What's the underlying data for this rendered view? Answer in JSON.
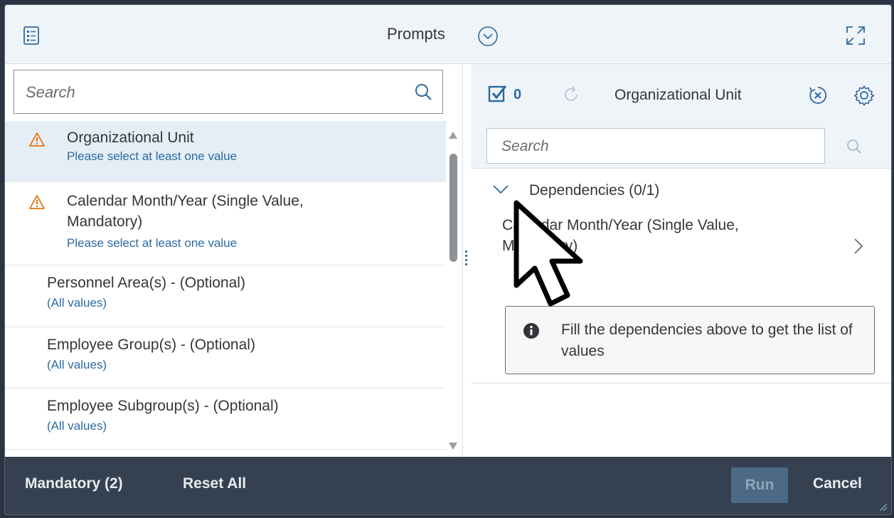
{
  "header": {
    "title": "Prompts"
  },
  "left_panel": {
    "search": {
      "placeholder": "Search",
      "value": ""
    },
    "items": [
      {
        "label": "Organizational Unit",
        "status": "Please select at least one value",
        "warning": true,
        "selected": true
      },
      {
        "label": "Calendar Month/Year (Single Value, Mandatory)",
        "label_line1": "Calendar Month/Year (Single Value,",
        "label_line2": "Mandatory)",
        "status": "Please select at least one value",
        "warning": true,
        "selected": false
      },
      {
        "label": "Personnel Area(s) - (Optional)",
        "status": "(All values)",
        "warning": false,
        "selected": false
      },
      {
        "label": "Employee Group(s) - (Optional)",
        "status": "(All values)",
        "warning": false,
        "selected": false
      },
      {
        "label": "Employee Subgroup(s) - (Optional)",
        "status": "(All values)",
        "warning": false,
        "selected": false
      }
    ]
  },
  "right_panel": {
    "selected_count": "0",
    "title": "Organizational Unit",
    "search": {
      "placeholder": "Search",
      "value": ""
    },
    "dependencies": {
      "header": "Dependencies (0/1)",
      "items": [
        {
          "line1": "Calendar Month/Year (Single Value,",
          "line2": "Mandatory)"
        }
      ]
    },
    "info_message": "Fill the dependencies above to get the list of values"
  },
  "footer": {
    "mandatory": "Mandatory (2)",
    "reset_all": "Reset All",
    "run": "Run",
    "cancel": "Cancel"
  },
  "colors": {
    "accent": "#2c6aa0",
    "warning": "#e9730c",
    "footer_bg": "#354150",
    "header_bg": "#eff4f9",
    "selected_bg": "#e5eef6"
  }
}
